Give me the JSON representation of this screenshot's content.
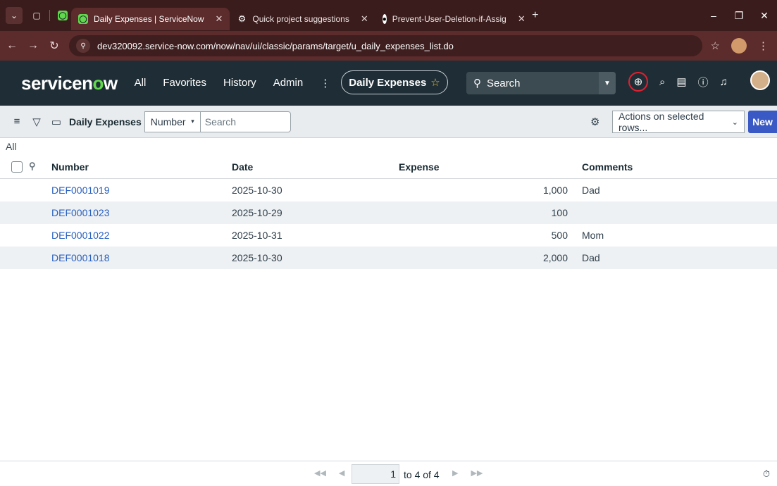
{
  "browser": {
    "tabs": [
      {
        "title": "Daily Expenses | ServiceNow",
        "active": true
      },
      {
        "title": "Quick project suggestions",
        "active": false
      },
      {
        "title": "Prevent-User-Deletion-if-Assig",
        "active": false
      }
    ],
    "url": "dev320092.service-now.com/now/nav/ui/classic/params/target/u_daily_expenses_list.do"
  },
  "header": {
    "logo_pre": "servicen",
    "logo_o": "o",
    "logo_post": "w",
    "nav": [
      "All",
      "Favorites",
      "History",
      "Admin"
    ],
    "context": "Daily Expenses",
    "search_placeholder": "Search"
  },
  "list": {
    "title": "Daily Expenses",
    "field": "Number",
    "search_placeholder": "Search",
    "actions": "Actions on selected rows...",
    "new_label": "New",
    "breadcrumb": "All",
    "columns": [
      "Number",
      "Date",
      "Expense",
      "Comments"
    ],
    "rows": [
      {
        "number": "DEF0001019",
        "date": "2025-10-30",
        "expense": "1,000",
        "comments": "Dad"
      },
      {
        "number": "DEF0001023",
        "date": "2025-10-29",
        "expense": "100",
        "comments": ""
      },
      {
        "number": "DEF0001022",
        "date": "2025-10-31",
        "expense": "500",
        "comments": "Mom"
      },
      {
        "number": "DEF0001018",
        "date": "2025-10-30",
        "expense": "2,000",
        "comments": "Dad"
      }
    ]
  },
  "pager": {
    "page": "1",
    "range_text": "to 4 of 4"
  }
}
